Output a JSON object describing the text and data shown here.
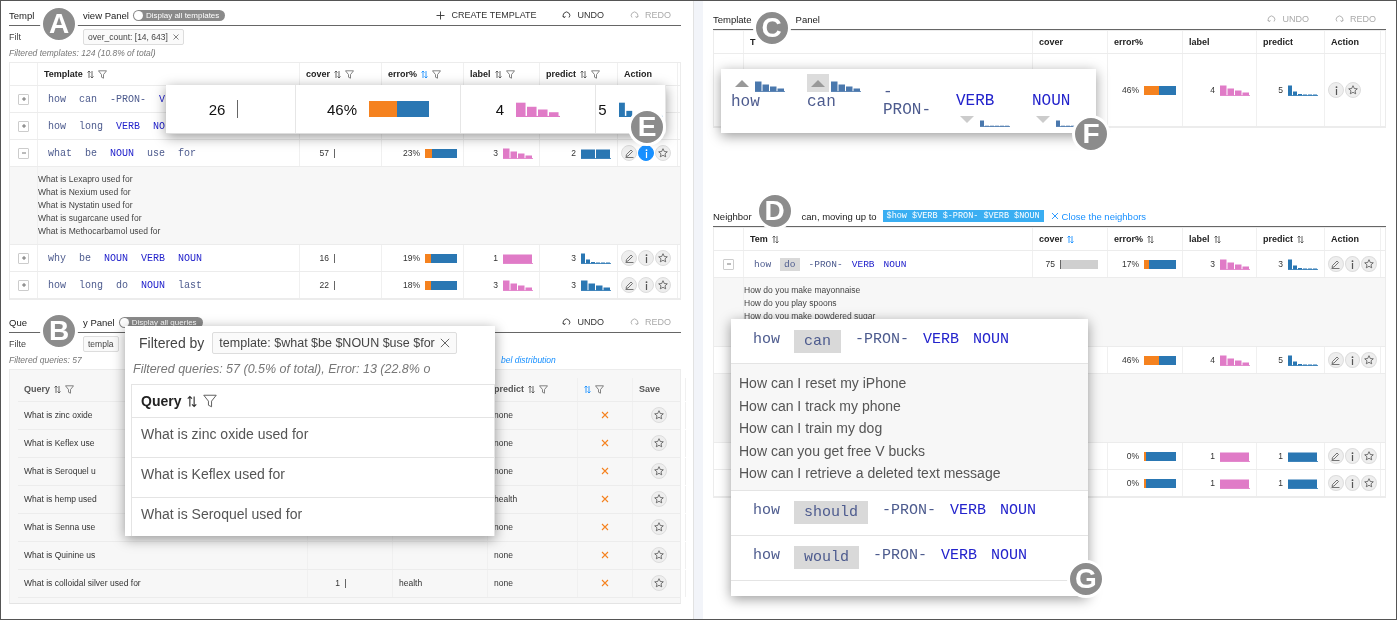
{
  "template_panel": {
    "title_parts": [
      "Templ",
      "view Panel"
    ],
    "toggle": {
      "label": "Display all templates",
      "on": false
    },
    "actions": [
      {
        "kind": "add",
        "label": "CREATE TEMPLATE",
        "disabled": false
      },
      {
        "kind": "undo",
        "label": "UNDO",
        "disabled": false
      },
      {
        "kind": "redo",
        "label": "REDO",
        "disabled": true
      }
    ],
    "filter_label": "Filt",
    "filter_chip": "over_count: [14, 643]",
    "summary": "Filtered templates: 124 (10.8% of total)",
    "columns": [
      {
        "label": "Template",
        "sort_active": false,
        "filter": true
      },
      {
        "label": "cover",
        "sort_active": false,
        "filter": true
      },
      {
        "label": "error%",
        "sort_active": true,
        "filter": true
      },
      {
        "label": "label",
        "sort_active": false,
        "filter": true
      },
      {
        "label": "predict",
        "sort_active": false,
        "filter": true
      },
      {
        "label": "Action"
      }
    ],
    "rows": [
      {
        "expanded": false,
        "tokens": [
          {
            "text": "how",
            "kind": "word"
          },
          {
            "text": "can",
            "kind": "word"
          },
          {
            "text": "-PRON-",
            "kind": "word"
          },
          {
            "text": "V",
            "kind": "pos"
          }
        ]
      },
      {
        "expanded": false,
        "tokens": [
          {
            "text": "how",
            "kind": "word"
          },
          {
            "text": "long",
            "kind": "word"
          },
          {
            "text": "VERB",
            "kind": "pos"
          },
          {
            "text": "NO",
            "kind": "pos"
          }
        ]
      },
      {
        "expanded": true,
        "tokens": [
          {
            "text": "what",
            "kind": "word"
          },
          {
            "text": "be",
            "kind": "word"
          },
          {
            "text": "NOUN",
            "kind": "pos"
          },
          {
            "text": "use",
            "kind": "word"
          },
          {
            "text": "for",
            "kind": "word"
          }
        ],
        "cover": {
          "text": "57"
        },
        "error": {
          "text": "23%",
          "level": 0.23
        },
        "label": {
          "text": "3",
          "kind": "decay"
        },
        "predict": {
          "text": "2",
          "kind": "pair"
        },
        "actions": [
          {
            "kind": "edit",
            "selected": false
          },
          {
            "kind": "info",
            "selected": true
          },
          {
            "kind": "star",
            "selected": false
          }
        ],
        "queries": [
          "What is Lexapro used for",
          "What is Nexium used for",
          "What is Nystatin used for",
          "What is sugarcane used for",
          "What is Methocarbamol used for"
        ]
      },
      {
        "expanded": false,
        "tokens": [
          {
            "text": "why",
            "kind": "word"
          },
          {
            "text": "be",
            "kind": "word"
          },
          {
            "text": "NOUN",
            "kind": "pos"
          },
          {
            "text": "VERB",
            "kind": "pos"
          },
          {
            "text": "NOUN",
            "kind": "pos"
          }
        ],
        "cover": {
          "text": "16"
        },
        "error": {
          "text": "19%",
          "level": 0.19
        },
        "label": {
          "text": "1",
          "kind": "single"
        },
        "predict": {
          "text": "3",
          "kind": "steep"
        },
        "actions": [
          {
            "kind": "edit",
            "selected": false
          },
          {
            "kind": "info",
            "selected": false
          },
          {
            "kind": "star",
            "selected": false
          }
        ]
      },
      {
        "expanded": false,
        "tokens": [
          {
            "text": "how",
            "kind": "word"
          },
          {
            "text": "long",
            "kind": "word"
          },
          {
            "text": "do",
            "kind": "word"
          },
          {
            "text": "NOUN",
            "kind": "pos"
          },
          {
            "text": "last",
            "kind": "word"
          }
        ],
        "cover": {
          "text": "22"
        },
        "error": {
          "text": "18%",
          "level": 0.18
        },
        "label": {
          "text": "3",
          "kind": "decay"
        },
        "predict": {
          "text": "3",
          "kind": "decay"
        },
        "actions": [
          {
            "kind": "edit",
            "selected": false
          },
          {
            "kind": "info",
            "selected": false
          },
          {
            "kind": "star",
            "selected": false
          }
        ]
      }
    ]
  },
  "template_zoom": {
    "cover": {
      "text": "26"
    },
    "error": {
      "text": "46%",
      "level": 0.46
    },
    "label": {
      "text": "4",
      "kind": "decay"
    },
    "predict": {
      "text": "5",
      "kind": "steep"
    }
  },
  "query_panel": {
    "title_parts": [
      "Que",
      "y Panel"
    ],
    "toggle": {
      "label": "Display all queries",
      "on": false
    },
    "actions": [
      {
        "kind": "undo",
        "label": "UNDO",
        "disabled": false
      },
      {
        "kind": "redo",
        "label": "REDO",
        "disabled": true
      }
    ],
    "filter_label": "Filte",
    "filter_chip": "templa",
    "summary": "Filtered queries: 57",
    "link": "bel distribution",
    "columns": [
      {
        "label": "Query",
        "sort_active": false,
        "filter": true
      },
      {},
      {},
      {
        "label": "predict",
        "sort_active": false,
        "filter": true
      },
      {
        "sort_active": true,
        "filter": true
      },
      {
        "label": "Save"
      }
    ],
    "rows": [
      {
        "query": "What is zinc oxide",
        "predict": "none",
        "error": true
      },
      {
        "query": "What is Keflex use",
        "predict": "none",
        "error": true
      },
      {
        "query": "What is Seroquel u",
        "predict": "none",
        "error": true
      },
      {
        "query": "What is hemp used",
        "predict": "health",
        "error": true
      },
      {
        "query": "What is Senna use",
        "predict": "none",
        "error": true
      },
      {
        "query": "What is Quinine us",
        "predict": "none",
        "error": true
      },
      {
        "query": "What is colloidal silver used for",
        "cover": {
          "text": "1"
        },
        "label": "health",
        "predict": "none",
        "error": true
      }
    ]
  },
  "query_zoom": {
    "filter_label": "Filtered by",
    "chip": "template: $what $be $NOUN $use $for",
    "summary": "Filtered queries: 57 (0.5% of total), Error: 13 (22.8% o",
    "column": "Query",
    "rows": [
      "What is zinc oxide used for",
      "What is Keflex used for",
      "What is Seroquel used for"
    ]
  },
  "template_detail": {
    "title_parts": [
      "Template",
      "Panel"
    ],
    "actions": [
      {
        "kind": "undo",
        "label": "UNDO",
        "disabled": true
      },
      {
        "kind": "redo",
        "label": "REDO",
        "disabled": true
      }
    ],
    "columns": [
      {
        "label": "T"
      },
      {
        "label": "cover"
      },
      {
        "label": "error%"
      },
      {
        "label": "label"
      },
      {
        "label": "predict"
      },
      {
        "label": "Action"
      }
    ],
    "row": {
      "error": {
        "text": "46%",
        "level": 0.46
      },
      "label": {
        "text": "4",
        "kind": "decay"
      },
      "predict": {
        "text": "5",
        "kind": "steep"
      },
      "actions": [
        {
          "kind": "info",
          "selected": false
        },
        {
          "kind": "star",
          "selected": false
        }
      ]
    }
  },
  "token_zoom": {
    "tokens": [
      {
        "text": "how",
        "kind": "word",
        "move_up": true,
        "move_down": false,
        "selected": false
      },
      {
        "text": "can",
        "kind": "word",
        "move_up": true,
        "move_down": false,
        "selected": true
      },
      {
        "text": "-PRON-",
        "kind": "word",
        "move_up": false,
        "move_down": false
      },
      {
        "text": "VERB",
        "kind": "pos",
        "move_up": false,
        "move_down": true,
        "selected": false
      },
      {
        "text": "NOUN",
        "kind": "pos",
        "move_up": false,
        "move_down": true,
        "selected": false
      }
    ]
  },
  "neighbors": {
    "heading_parts": [
      "Neighbor",
      "can, moving up to"
    ],
    "template_tag": "$how $VERB $-PRON- $VERB $NOUN",
    "close_link": "Close the neighbors",
    "columns": [
      {
        "label": "Tem",
        "sort_active": false
      },
      {
        "label": "cover",
        "sort_active": true
      },
      {
        "label": "error%",
        "sort_active": false
      },
      {
        "label": "label",
        "sort_active": false
      },
      {
        "label": "predict",
        "sort_active": false
      },
      {
        "label": "Action"
      }
    ],
    "rows": [
      {
        "expanded": true,
        "tokens": [
          {
            "text": "how",
            "kind": "word",
            "selected": false
          },
          {
            "text": "do",
            "kind": "word",
            "selected": true
          },
          {
            "text": "-PRON-",
            "kind": "word",
            "selected": false
          },
          {
            "text": "VERB",
            "kind": "pos",
            "selected": false
          },
          {
            "text": "NOUN",
            "kind": "pos",
            "selected": false
          }
        ],
        "cover": {
          "text": "75",
          "level": 0.92
        },
        "error": {
          "text": "17%",
          "level": 0.17
        },
        "label": {
          "text": "3",
          "kind": "decay"
        },
        "predict": {
          "text": "3",
          "kind": "steep"
        },
        "actions": [
          {
            "kind": "edit",
            "selected": false
          },
          {
            "kind": "info",
            "selected": false
          },
          {
            "kind": "star",
            "selected": false
          }
        ],
        "queries": [
          "How do you make mayonnaise",
          "How do you play spoons",
          "How do you make powdered sugar"
        ]
      },
      {
        "expanded": true,
        "error": {
          "text": "46%",
          "level": 0.46
        },
        "label": {
          "text": "4",
          "kind": "decay"
        },
        "predict": {
          "text": "5",
          "kind": "steep"
        },
        "actions": [
          {
            "kind": "edit",
            "selected": false
          },
          {
            "kind": "info",
            "selected": false
          },
          {
            "kind": "star",
            "selected": false
          }
        ]
      },
      {
        "error": {
          "text": "0%",
          "level": 0
        },
        "label": {
          "text": "1",
          "kind": "single"
        },
        "predict": {
          "text": "1",
          "kind": "single"
        },
        "actions": [
          {
            "kind": "edit",
            "selected": false
          },
          {
            "kind": "info",
            "selected": false
          },
          {
            "kind": "star",
            "selected": false
          }
        ]
      },
      {
        "error": {
          "text": "0%",
          "level": 0
        },
        "label": {
          "text": "1",
          "kind": "single"
        },
        "predict": {
          "text": "1",
          "kind": "single"
        },
        "actions": [
          {
            "kind": "edit",
            "selected": false
          },
          {
            "kind": "info",
            "selected": false
          },
          {
            "kind": "star",
            "selected": false
          }
        ]
      }
    ]
  },
  "neighbor_zoom": {
    "groups": [
      {
        "tokens": [
          {
            "text": "how",
            "kind": "word",
            "selected": false
          },
          {
            "text": "can",
            "kind": "word",
            "selected": true
          },
          {
            "text": "-PRON-",
            "kind": "word",
            "selected": false
          },
          {
            "text": "VERB",
            "kind": "pos",
            "selected": false
          },
          {
            "text": "NOUN",
            "kind": "pos",
            "selected": false
          }
        ],
        "queries": [
          "How can I reset my iPhone",
          "How can I track my phone",
          "How can I train my dog",
          "How can you get free V bucks",
          "How can I retrieve a deleted text message"
        ]
      },
      {
        "tokens": [
          {
            "text": "how",
            "kind": "word",
            "selected": false
          },
          {
            "text": "should",
            "kind": "word",
            "selected": true
          },
          {
            "text": "-PRON-",
            "kind": "word",
            "selected": false
          },
          {
            "text": "VERB",
            "kind": "pos",
            "selected": false
          },
          {
            "text": "NOUN",
            "kind": "pos",
            "selected": false
          }
        ]
      },
      {
        "tokens": [
          {
            "text": "how",
            "kind": "word",
            "selected": false
          },
          {
            "text": "would",
            "kind": "word",
            "selected": true
          },
          {
            "text": "-PRON-",
            "kind": "word",
            "selected": false
          },
          {
            "text": "VERB",
            "kind": "pos",
            "selected": false
          },
          {
            "text": "NOUN",
            "kind": "pos",
            "selected": false
          }
        ]
      }
    ]
  },
  "callouts": [
    {
      "letter": "A"
    },
    {
      "letter": "B"
    },
    {
      "letter": "C"
    },
    {
      "letter": "D"
    },
    {
      "letter": "E"
    },
    {
      "letter": "F"
    },
    {
      "letter": "G"
    }
  ]
}
